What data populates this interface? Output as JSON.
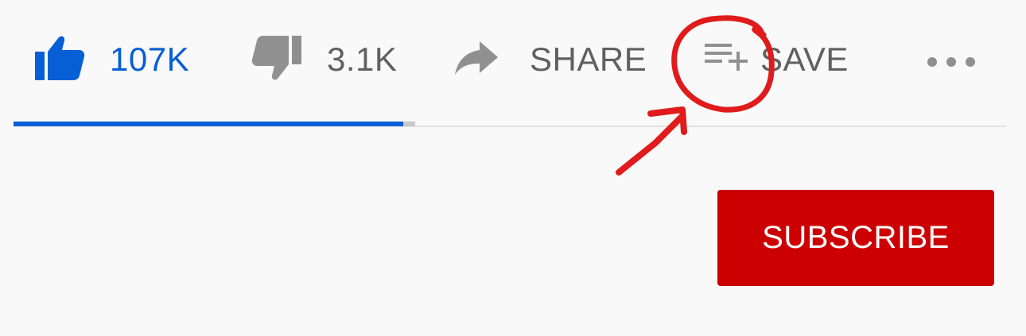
{
  "actions": {
    "like": {
      "icon": "thumbs-up-icon",
      "count": "107K",
      "color": "#065fd4",
      "active": true
    },
    "dislike": {
      "icon": "thumbs-down-icon",
      "count": "3.1K",
      "color": "#606060"
    },
    "share": {
      "icon": "share-arrow-icon",
      "label": "SHARE",
      "color": "#606060"
    },
    "save": {
      "icon": "playlist-add-icon",
      "label": "SAVE",
      "color": "#606060"
    },
    "more": {
      "icon": "more-horizontal-icon"
    }
  },
  "sentiment": {
    "like_fraction": 0.97,
    "fill_color": "#065fd4",
    "track_color": "#c9c9c9"
  },
  "subscribe": {
    "label": "SUBSCRIBE",
    "background": "#cc0000",
    "text_color": "#ffffff"
  },
  "annotation": {
    "shapes": [
      "hand-drawn-circle",
      "hand-drawn-arrow"
    ],
    "color": "#e01b1b",
    "target": "save"
  }
}
